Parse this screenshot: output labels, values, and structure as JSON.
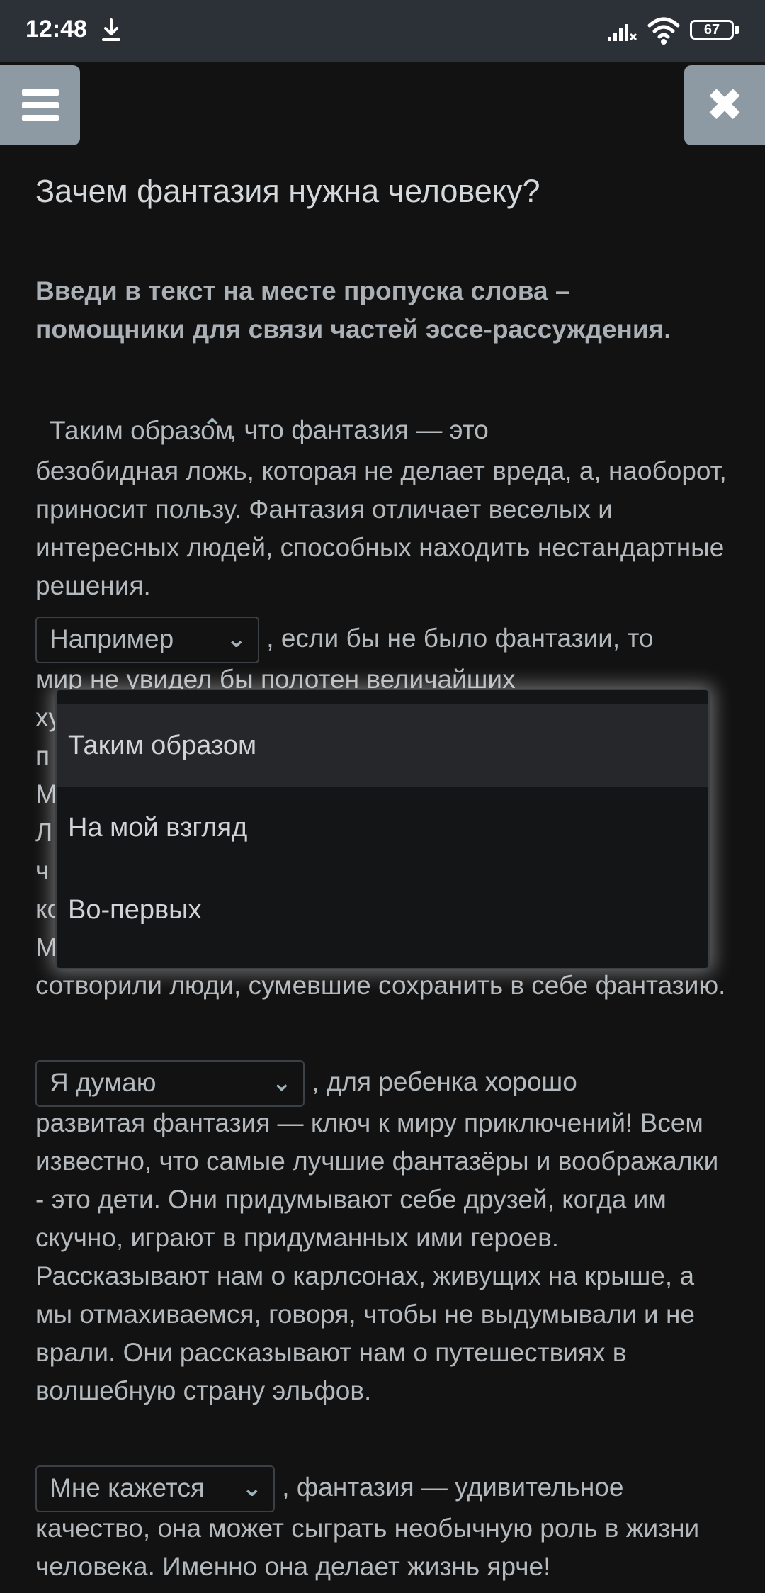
{
  "status_bar": {
    "time": "12:48",
    "battery": "67"
  },
  "page": {
    "title": "Зачем фантазия нужна человеку?",
    "instruction": "Введи в текст на месте пропуска слова – помощники для связи частей эссе-рассуждения."
  },
  "paragraphs": [
    {
      "dropdown_value": "Таким образом",
      "line1": ", что фантазия — это",
      "rest": "безобидная ложь, которая не делает вреда, а, наоборот, приносит пользу. Фантазия отличает веселых и интересных людей, способных находить нестандартные решения."
    },
    {
      "dropdown_value": "Например",
      "line1": ", если бы не было фантазии, то",
      "line2": "мир не увидел бы полотен величайших",
      "covered_initials": [
        "ху",
        "п",
        "М",
        "Л",
        "ч",
        "ко",
        "М"
      ],
      "end": "сотворили люди, сумевшие сохранить в себе фантазию."
    },
    {
      "dropdown_value": "Я думаю",
      "line1": ", для ребенка хорошо",
      "rest": "развитая фантазия — ключ к миру приключений! Всем известно, что самые лучшие фантазёры и воображалки - это дети. Они придумывают себе друзей, когда им скучно, играют в придуманных ими героев. Рассказывают нам о карлсонах, живущих на крыше, а мы отмахиваемся, говоря, чтобы не выдумывали и не врали. Они рассказывают нам о путешествиях в волшебную страну эльфов."
    },
    {
      "dropdown_value": "Мне кажется",
      "line1": ", фантазия — удивительное",
      "rest": "качество, она может сыграть необычную роль в жизни человека. Именно она делает жизнь ярче!"
    }
  ],
  "dropdown_options": [
    "Таким образом",
    "На мой взгляд",
    "Во-первых"
  ],
  "icons": {
    "menu": "hamburger-icon",
    "close": "close-icon"
  },
  "colors": {
    "background": "#121212",
    "status_bar": "#2c3138",
    "corner_buttons": "#8e9aa3",
    "text": "#b4b9bd"
  }
}
